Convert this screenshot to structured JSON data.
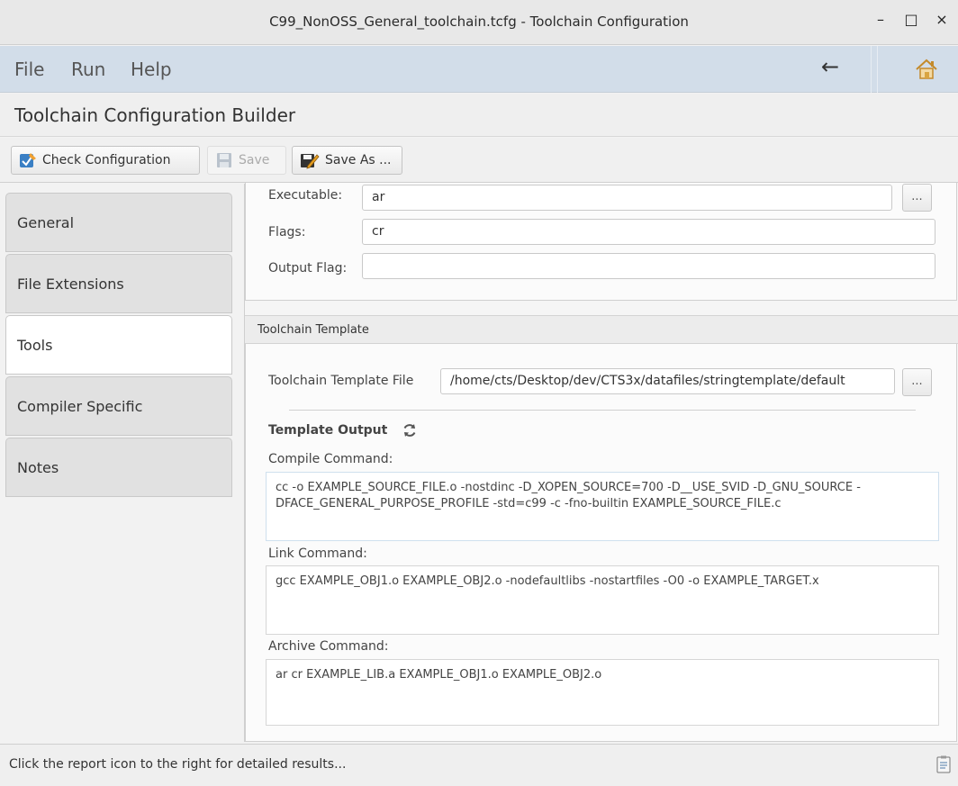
{
  "window": {
    "title": "C99_NonOSS_General_toolchain.tcfg - Toolchain Configuration",
    "minimize": "–",
    "maximize": "□",
    "close": "×"
  },
  "menubar": {
    "items": [
      "File",
      "Run",
      "Help"
    ],
    "back_symbol": "←"
  },
  "heading": "Toolchain Configuration Builder",
  "toolbar": {
    "check_label": "Check Configuration",
    "save_label": "Save",
    "save_as_label": "Save As ..."
  },
  "sidebar": {
    "tabs": [
      "General",
      "File Extensions",
      "Tools",
      "Compiler Specific",
      "Notes"
    ],
    "active": "Tools"
  },
  "tool": {
    "executable_label": "Executable:",
    "executable_value": "ar",
    "flags_label": "Flags:",
    "flags_value": "cr",
    "output_flag_label": "Output Flag:",
    "output_flag_value": "",
    "browse_label": "..."
  },
  "template": {
    "section_title": "Toolchain Template",
    "file_label": "Toolchain Template File",
    "file_value": "/home/cts/Desktop/dev/CTS3x/datafiles/stringtemplate/default",
    "browse_label": "...",
    "output_title": "Template Output",
    "compile_label": "Compile Command:",
    "compile_value": "cc -o EXAMPLE_SOURCE_FILE.o -nostdinc -D_XOPEN_SOURCE=700 -D__USE_SVID -D_GNU_SOURCE -DFACE_GENERAL_PURPOSE_PROFILE -std=c99 -c -fno-builtin EXAMPLE_SOURCE_FILE.c",
    "link_label": "Link Command:",
    "link_value": "gcc EXAMPLE_OBJ1.o EXAMPLE_OBJ2.o -nodefaultlibs -nostartfiles -O0 -o EXAMPLE_TARGET.x",
    "archive_label": "Archive Command:",
    "archive_value": "ar cr EXAMPLE_LIB.a EXAMPLE_OBJ1.o EXAMPLE_OBJ2.o"
  },
  "status": {
    "text": "Click the report icon to the right for detailed results..."
  },
  "icons": {
    "check": "check-config-icon",
    "save": "floppy-disk-icon",
    "save_as": "save-as-pencil-icon",
    "refresh": "refresh-icon",
    "home": "home-icon",
    "report": "report-icon"
  },
  "colors": {
    "menubar_bg": "#d2dde9",
    "home_icon": "#d9a441",
    "check_icon": "#3a7fc4",
    "active_tab_bg": "#ffffff",
    "inactive_tab_bg": "#e1e1e1"
  }
}
